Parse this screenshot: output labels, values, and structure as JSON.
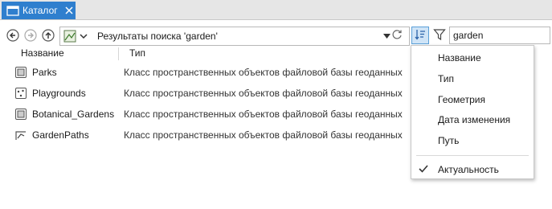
{
  "tab": {
    "title": "Каталог",
    "icon": "catalog-window-icon",
    "close_icon": "close-icon",
    "accent": "#2f7fce"
  },
  "toolbar": {
    "back_icon": "back-arrow-icon",
    "forward_icon": "forward-arrow-icon",
    "up_icon": "up-arrow-icon",
    "location_text": "Результаты поиска 'garden'",
    "refresh_icon": "refresh-icon",
    "sort_icon": "sort-icon",
    "filter_icon": "filter-icon",
    "search_value": "garden"
  },
  "columns": {
    "name": "Название",
    "type": "Тип"
  },
  "rows": [
    {
      "name": "Parks",
      "type": "Класс пространственных объектов файловой базы геоданных",
      "icon": "polygon-feature-class-icon"
    },
    {
      "name": "Playgrounds",
      "type": "Класс пространственных объектов файловой базы геоданных",
      "icon": "point-feature-class-icon"
    },
    {
      "name": "Botanical_Gardens",
      "type": "Класс пространственных объектов файловой базы геоданных",
      "icon": "polygon-feature-class-icon"
    },
    {
      "name": "GardenPaths",
      "type": "Класс пространственных объектов файловой базы геоданных",
      "icon": "line-feature-class-icon"
    }
  ],
  "sort_menu": {
    "items": [
      "Название",
      "Тип",
      "Геометрия",
      "Дата изменения",
      "Путь"
    ],
    "checked_item": "Актуальность"
  }
}
